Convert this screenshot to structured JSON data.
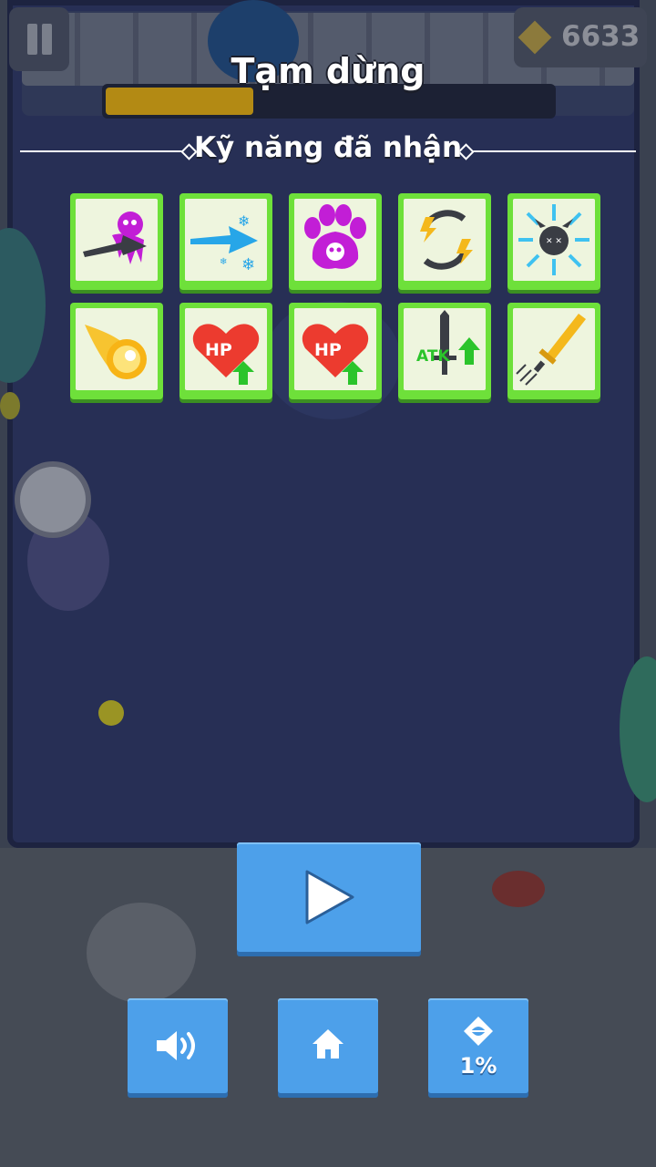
{
  "hud": {
    "gem_count": "6633",
    "boss_hp_fraction": 0.33
  },
  "pause_menu": {
    "title": "Tạm dừng",
    "section_title": "Kỹ năng đã nhận"
  },
  "skills": [
    {
      "name": "poison-arrow-skill-icon",
      "label": ""
    },
    {
      "name": "freeze-arrow-skill-icon",
      "label": ""
    },
    {
      "name": "poison-pet-skill-icon",
      "label": ""
    },
    {
      "name": "lightning-circle-skill-icon",
      "label": ""
    },
    {
      "name": "freeze-skull-skill-icon",
      "label": ""
    },
    {
      "name": "fireball-skill-icon",
      "label": ""
    },
    {
      "name": "hp-up-skill-icon",
      "label": "HP"
    },
    {
      "name": "hp-up-skill-icon",
      "label": "HP"
    },
    {
      "name": "atk-up-skill-icon",
      "label": "ATK"
    },
    {
      "name": "fast-sword-skill-icon",
      "label": ""
    }
  ],
  "buttons": {
    "play": "play-icon",
    "sound": "speaker-icon",
    "home": "home-icon",
    "auto": "auto-aim-icon",
    "auto_percent": "1%"
  },
  "colors": {
    "skill_border": "#6ee03a",
    "button_blue": "#4da0ea",
    "arena": "#272f55"
  }
}
